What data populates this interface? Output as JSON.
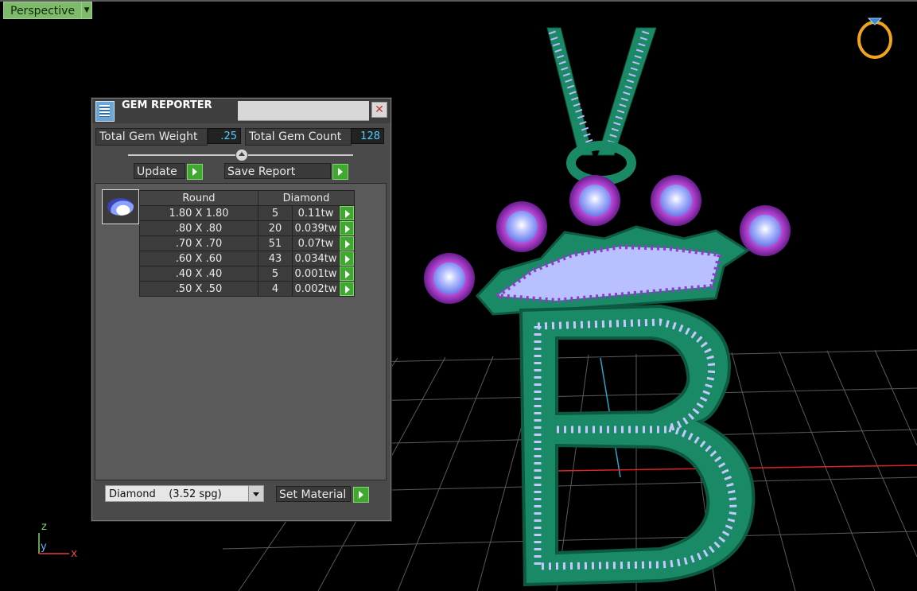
{
  "viewport": {
    "label": "Perspective",
    "dropdown_icon": "chevron-down-icon",
    "nav_icon": "ring-icon",
    "axes": {
      "z": "z",
      "y": "y",
      "x": "x"
    }
  },
  "gem_reporter": {
    "title": "GEM REPORTER",
    "close_icon": "close-icon",
    "total_weight_label": "Total Gem Weight",
    "total_weight_value": ".25",
    "total_count_label": "Total Gem Count",
    "total_count_value": "128",
    "update_label": "Update",
    "save_report_label": "Save Report",
    "table": {
      "headers": [
        "Round",
        "Diamond"
      ],
      "rows": [
        {
          "size": "1.80 X 1.80",
          "count": "5",
          "tw": "0.11tw"
        },
        {
          "size": ".80 X .80",
          "count": "20",
          "tw": "0.039tw"
        },
        {
          "size": ".70 X .70",
          "count": "51",
          "tw": "0.07tw"
        },
        {
          "size": ".60 X .60",
          "count": "43",
          "tw": "0.034tw"
        },
        {
          "size": ".40 X .40",
          "count": "5",
          "tw": "0.001tw"
        },
        {
          "size": ".50 X .50",
          "count": "4",
          "tw": "0.002tw"
        }
      ]
    },
    "material": {
      "name": "Diamond",
      "spg": "(3.52 spg)"
    },
    "set_material_label": "Set Material"
  },
  "colors": {
    "accent_green": "#3fa92f",
    "value_cyan": "#4dd2ff",
    "metal_green": "#1f8f6e",
    "gem_purple": "#8c3cc8"
  }
}
